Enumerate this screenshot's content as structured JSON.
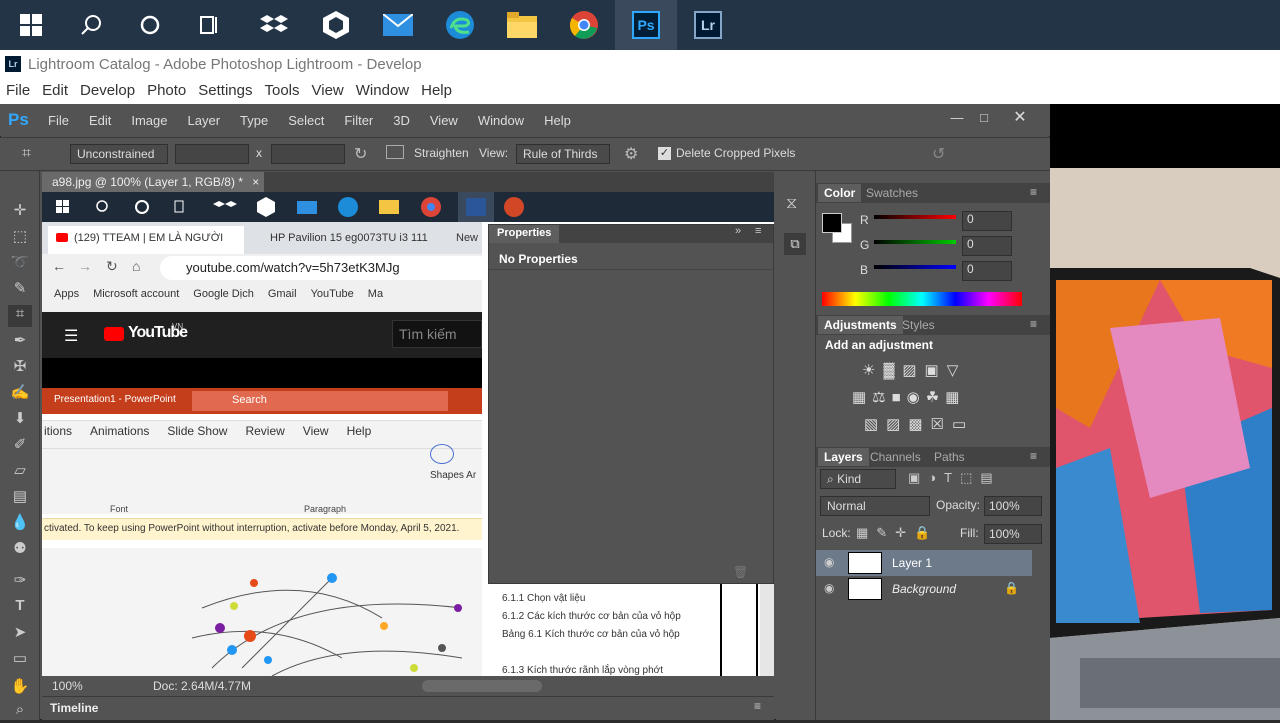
{
  "taskbar": {
    "apps": [
      "windows-start",
      "search",
      "cortana",
      "task-view",
      "dropbox",
      "app-hex",
      "mail",
      "edge",
      "file-explorer",
      "chrome",
      "photoshop",
      "lightroom"
    ]
  },
  "lightroom": {
    "title": "Lightroom Catalog - Adobe Photoshop Lightroom - Develop",
    "menu": [
      "File",
      "Edit",
      "Develop",
      "Photo",
      "Settings",
      "Tools",
      "View",
      "Window",
      "Help"
    ]
  },
  "ps": {
    "logo": "Ps",
    "menu": [
      "File",
      "Edit",
      "Image",
      "Layer",
      "Type",
      "Select",
      "Filter",
      "3D",
      "View",
      "Window",
      "Help"
    ],
    "options": {
      "ratio": "Unconstrained",
      "x": "x",
      "straighten": "Straighten",
      "view_label": "View:",
      "view_value": "Rule of Thirds",
      "delete_cropped": "Delete Cropped Pixels"
    },
    "doc_tab": "a98.jpg @ 100% (Layer 1, RGB/8) *",
    "close": "×",
    "status": {
      "zoom": "100%",
      "doc": "Doc: 2.64M/4.77M"
    },
    "timeline": "Timeline",
    "properties": {
      "title": "Properties",
      "body": "No Properties"
    },
    "color": {
      "tabs": [
        "Color",
        "Swatches"
      ],
      "r": "R",
      "g": "G",
      "b": "B",
      "rv": "0",
      "gv": "0",
      "bv": "0"
    },
    "adjustments": {
      "tabs": [
        "Adjustments",
        "Styles"
      ],
      "hint": "Add an adjustment"
    },
    "layers": {
      "tabs": [
        "Layers",
        "Channels",
        "Paths"
      ],
      "kind": "Kind",
      "blend": "Normal",
      "opacity_label": "Opacity:",
      "opacity": "100%",
      "lock_label": "Lock:",
      "fill_label": "Fill:",
      "fill": "100%",
      "items": [
        "Layer 1",
        "Background"
      ]
    }
  },
  "inner": {
    "chrome_tabs": [
      "(129) TTEAM | EM LÀ NGƯỜI",
      "HP Pavilion 15 eg0073TU i3 111",
      "New"
    ],
    "url": "youtube.com/watch?v=5h73etK3MJg",
    "bookmarks": [
      "Apps",
      "Microsoft account",
      "Google Dịch",
      "Gmail",
      "YouTube",
      "Ma"
    ],
    "yt_logo": "YouTube",
    "yt_vn": "VN",
    "yt_search": "Tìm kiếm",
    "ppt_title": "Presentation1 - PowerPoint",
    "ppt_search": "Search",
    "ppt_tabs": [
      "itions",
      "Animations",
      "Slide Show",
      "Review",
      "View",
      "Help"
    ],
    "ppt_groups": [
      "Font",
      "Paragraph"
    ],
    "ppt_shapes": "Shapes Ar",
    "ppt_warning": "ctivated. To keep using PowerPoint without interruption, activate before Monday, April 5, 2021.",
    "doc_lines": [
      "6.1.1 Chọn vật liệu",
      "6.1.2 Các kích thước cơ bản của vỏ hộp",
      "Bảng 6.1 Kích thước cơ bản của vỏ hộp",
      "6.1.3 Kích thước rãnh lắp vòng phớt"
    ]
  }
}
